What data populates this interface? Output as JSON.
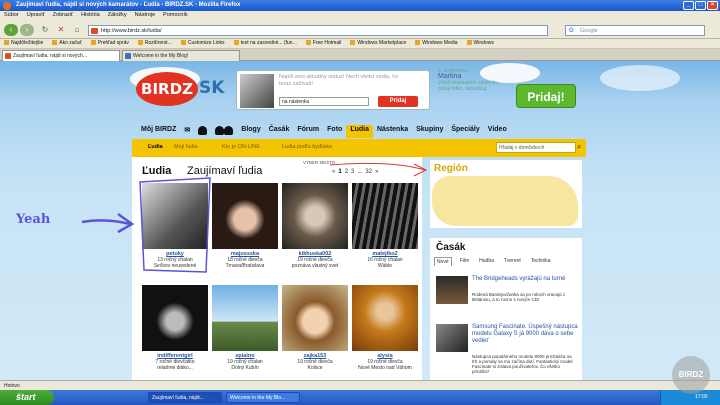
{
  "window": {
    "title": "Zaujímaví ľudia, nájdi si nových kamarátov - Ľudia - BIRDZ.SK - Mozilla Firefox"
  },
  "menu": [
    "Súbor",
    "Upraviť",
    "Zobraziť",
    "História",
    "Záložky",
    "Nástroje",
    "Pomocník"
  ],
  "nav": {
    "url": "http://www.birdz.sk/ludia/",
    "search_placeholder": "Google"
  },
  "bookmarks": [
    "Najdôležitejšie",
    "Ako začať",
    "Prehľad správ",
    "Rozšírené...",
    "Customize Links",
    "test na zasvedné... (fun...",
    "Free Hotmail",
    "Windows Marketplace",
    "Windows Media",
    "Windows"
  ],
  "tabs": [
    {
      "label": "Zaujímaví ľudia, nájdi si nových..."
    },
    {
      "label": "Welcome in the My Blog!"
    }
  ],
  "site": {
    "logo": "BIRDZ",
    "logo_suffix": "SK",
    "status_placeholder": "Napíš svoj aktuálny status! Nech všetci vedia, čo teraz zažívaš!",
    "status_target": "na nástenku",
    "pridaj_small": "Pridaj",
    "pridaj_big": "Pridaj!",
    "user_date": "9. septembra",
    "user_name": "Martina",
    "user_note": "Zmeň nastavenie nástenky, pridaj fotku, aktualizuj..."
  },
  "main_nav": [
    "Môj BIRDZ",
    "Blogy",
    "Časák",
    "Fórum",
    "Foto",
    "Ľudia",
    "Nástenka",
    "Skupiny",
    "Špeciály",
    "Video"
  ],
  "sub_nav": {
    "items": [
      "Ľudia",
      "Moji ľudia",
      "Kto je ON-LINE",
      "Ľudia podľa bydliska"
    ],
    "search_placeholder": "Hľadaj v domčekoch"
  },
  "people_section": {
    "title_bold": "Ľudia",
    "title": "Zaujímaví ľudia",
    "pager": [
      "«",
      "1",
      "2",
      "3",
      "...",
      "32",
      "»"
    ]
  },
  "people": [
    {
      "name": "petuky",
      "line1": "13 ročný chalan",
      "line2": "Sečkov neuvedené"
    },
    {
      "name": "majussska",
      "line1": "18 ročné dievča",
      "line2": "Trnava/Bratislava"
    },
    {
      "name": "kikhuska002",
      "line1": "19 ročné dievča",
      "line2": "poznáva vlastný svet"
    },
    {
      "name": "matejiko2",
      "line1": "16 ročný chalan",
      "line2": "Wäble"
    },
    {
      "name": "indifferentgirl",
      "line1": "7 ročné dievčatko",
      "line2": "relatíme diáko..."
    },
    {
      "name": "spiaino",
      "line1": "19 ročný chalan",
      "line2": "Dolný Kubín"
    },
    {
      "name": "zajka153",
      "line1": "19 ročné dievča",
      "line2": "Košice"
    },
    {
      "name": "alysia",
      "line1": "19 ročné dievča",
      "line2": "Nové Mesto nad Váhom"
    }
  ],
  "region": {
    "title": "Región"
  },
  "casak": {
    "title": "Časák",
    "tabs": [
      "Nové",
      "Film",
      "Hudba",
      "Tvenret",
      "Technika"
    ],
    "articles": [
      {
        "title": "The Bridgeheads vyrážajú na turné",
        "desc": "Rodená Bardejovčanka sa po rokoch vracajú z Britániou, a to rovno s novým CD!"
      },
      {
        "title": "Samsung Fascinate. Úspešný nástupca modelu Galaxy S já 9000 dáva o sebe vedieť",
        "desc": "Nástupca populárneho modelu 9000 prichádza na trh a pomaly sa mu začína darí. Fantastický model Fascinate si zislava používateľov. Čo všetko prináša?"
      }
    ]
  },
  "annotation": "Yeah",
  "annotation_small": "VÝBER MESTO",
  "statusbar": "Hotovo",
  "taskbar": {
    "start": "štart",
    "tasks": [
      "Zaujímaví ľudia, nájdi...",
      "Welcome in the My Blo..."
    ],
    "clock": "17:00"
  },
  "watermark": "BIRDZ"
}
